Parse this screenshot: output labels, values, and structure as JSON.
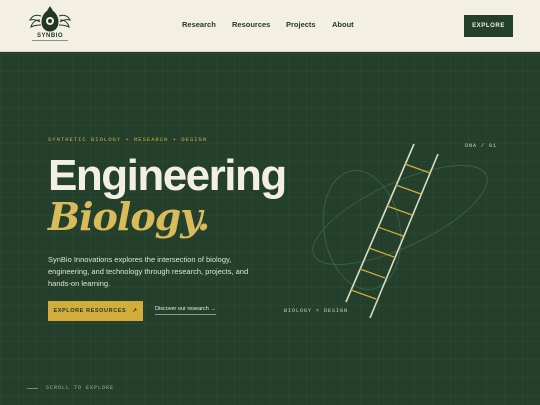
{
  "header": {
    "logo_text": "SYNBIO",
    "nav": [
      "Research",
      "Resources",
      "Projects",
      "About"
    ],
    "cta_label": "EXPLORE"
  },
  "hero": {
    "eyebrow": "SYNTHETIC BIOLOGY • RESEARCH • DESIGN",
    "title_line1": "Engineering",
    "title_line2": "Biology.",
    "description": "SynBio Innovations explores the intersection of biology, engineering, and technology through research, projects, and hands-on learning.",
    "primary_button": "EXPLORE RESOURCES",
    "primary_button_icon": "↗",
    "secondary_link": "Discover our research →",
    "graphic_tag_top": "DNA / 01",
    "graphic_tag_bottom": "BIOLOGY × DESIGN",
    "scroll_hint": "SCROLL TO EXPLORE"
  },
  "colors": {
    "background": "#24402c",
    "header": "#f3efe3",
    "accent": "#d2ad3c",
    "text_light": "#f3efe3"
  }
}
